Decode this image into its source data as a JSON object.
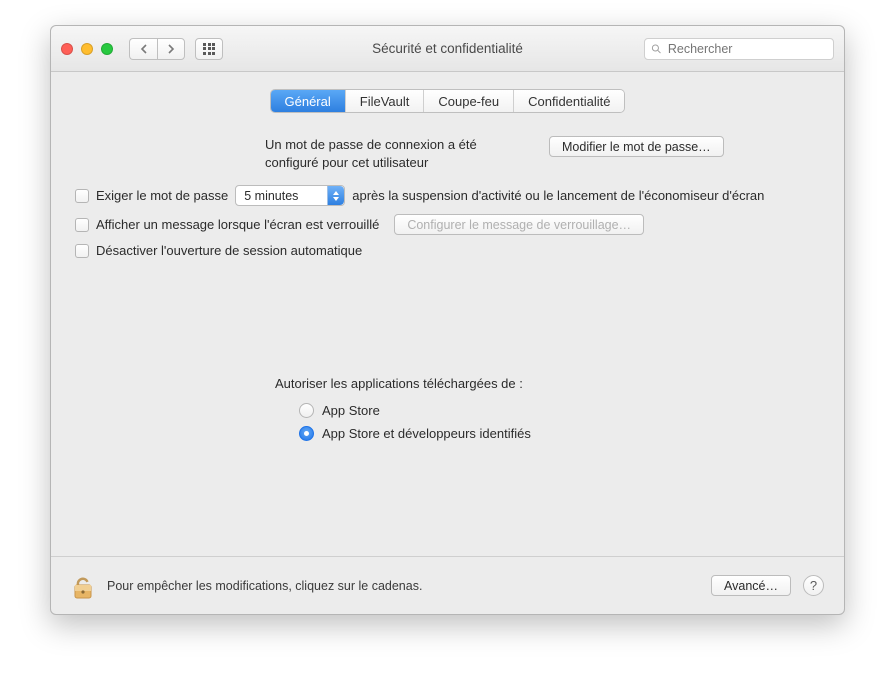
{
  "window": {
    "title": "Sécurité et confidentialité"
  },
  "search": {
    "placeholder": "Rechercher"
  },
  "tabs": {
    "general": "Général",
    "filevault": "FileVault",
    "firewall": "Coupe-feu",
    "privacy": "Confidentialité",
    "active": "general"
  },
  "general": {
    "password_set_msg": "Un mot de passe de connexion a été configuré pour cet utilisateur",
    "change_password_btn": "Modifier le mot de passe…",
    "require_password_label": "Exiger le mot de passe",
    "require_password_delay": "5 minutes",
    "require_password_suffix": "après la suspension d'activité ou le lancement de l'économiseur d'écran",
    "show_lock_message_label": "Afficher un message lorsque l'écran est verrouillé",
    "set_lock_message_btn": "Configurer le message de verrouillage…",
    "disable_autologin_label": "Désactiver l'ouverture de session automatique",
    "allow_apps_title": "Autoriser les applications téléchargées de :",
    "allow_apps_options": {
      "appstore": "App Store",
      "identified": "App Store et développeurs identifiés"
    },
    "allow_apps_selected": "identified"
  },
  "footer": {
    "lock_text": "Pour empêcher les modifications, cliquez sur le cadenas.",
    "advanced_btn": "Avancé…",
    "help": "?"
  }
}
